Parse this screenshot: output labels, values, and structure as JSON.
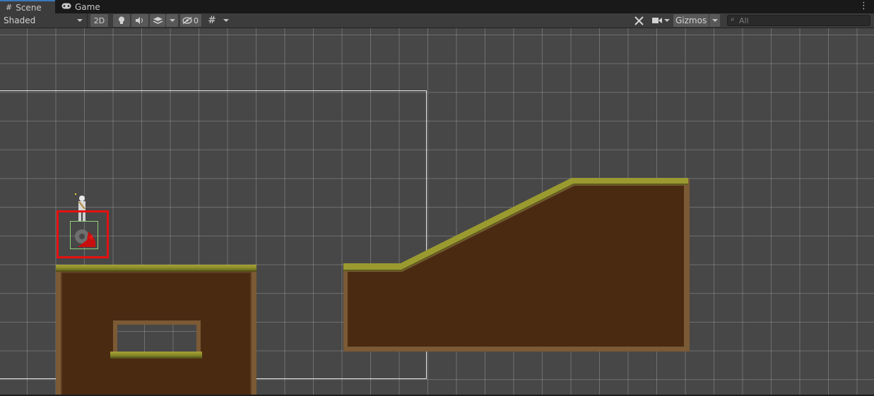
{
  "tabs": [
    {
      "label": "Scene",
      "icon": "grid-icon",
      "active": true
    },
    {
      "label": "Game",
      "icon": "gamepad-icon",
      "active": false
    }
  ],
  "toolbar": {
    "shading_mode": "Shaded",
    "mode_2d_label": "2D",
    "hidden_count": "0",
    "gizmos_label": "Gizmos",
    "search_placeholder": "All"
  },
  "colors": {
    "accent": "#3a79bb",
    "grid_bg": "#474747",
    "selection": "#e51010",
    "grass": "#8c8d2a",
    "dirt": "#4b2a12"
  }
}
